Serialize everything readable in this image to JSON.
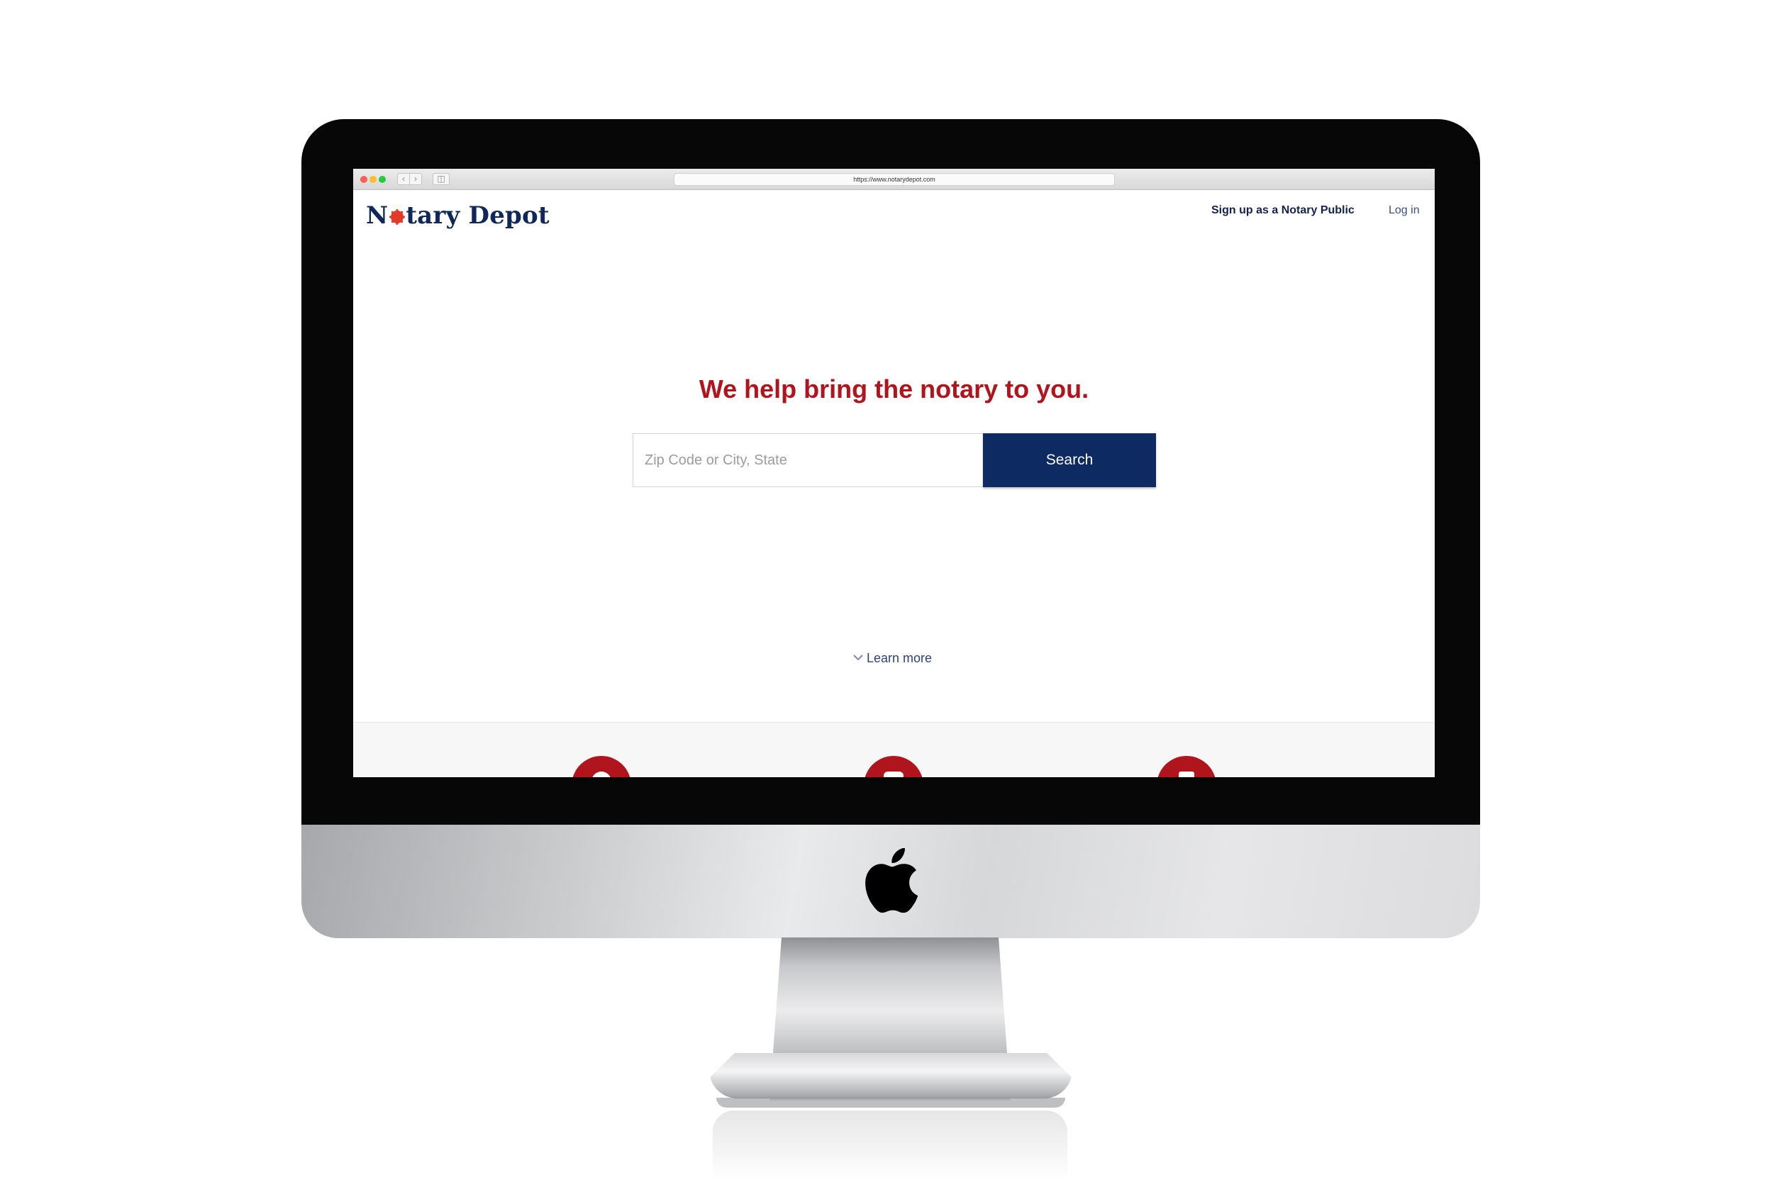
{
  "browser": {
    "url": "https://www.notarydepot.com"
  },
  "header": {
    "logo_text_before": "N",
    "logo_text_after": "tary Depot",
    "signup_label": "Sign up as a Notary Public",
    "login_label": "Log in"
  },
  "hero": {
    "headline": "We help bring the notary to you.",
    "search_placeholder": "Zip Code or City, State",
    "search_value": "",
    "search_button_label": "Search",
    "learn_more_label": "Learn more"
  },
  "features": {
    "icons": [
      "feature-icon-1",
      "feature-icon-2",
      "feature-icon-3"
    ]
  },
  "colors": {
    "brand_navy": "#0d2b62",
    "brand_red": "#b0151d",
    "link_blue": "#2f4378"
  }
}
